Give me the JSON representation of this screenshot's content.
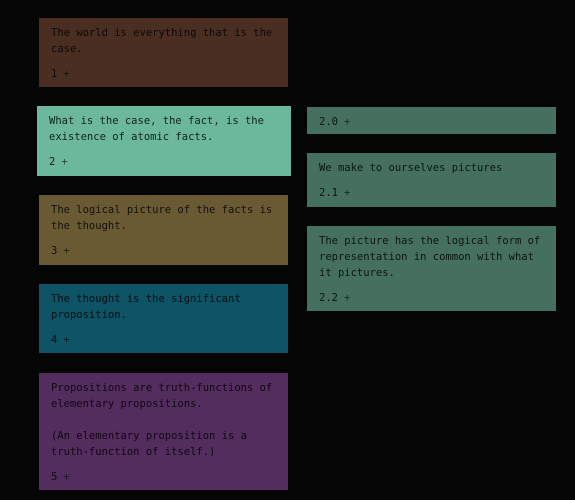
{
  "colors": {
    "background": "#050505",
    "card1": "#4a2e22",
    "card2": "#6cb89c",
    "card3": "#6a5a34",
    "card4": "#0e5366",
    "card5": "#522d5e",
    "child": "#45705f"
  },
  "main_column": [
    {
      "text": "The world is everything that is the case.",
      "number": "1",
      "add": "+"
    },
    {
      "text": "What is the case, the fact, is the existence of atomic facts.",
      "number": "2",
      "add": "+"
    },
    {
      "text": "The logical picture of the facts is the thought.",
      "number": "3",
      "add": "+"
    },
    {
      "text": "The thought is the significant proposition.",
      "number": "4",
      "add": "+"
    },
    {
      "text": "Propositions are truth-functions of elementary propositions.\n\n(An elementary proposition is a truth-function of itself.)",
      "number": "5",
      "add": "+"
    }
  ],
  "child_column": [
    {
      "text": "",
      "number": "2.0",
      "add": "+"
    },
    {
      "text": "We make to ourselves pictures",
      "number": "2.1",
      "add": "+"
    },
    {
      "text": "The picture has the logical form of representation in common with what it pictures.",
      "number": "2.2",
      "add": "+"
    }
  ]
}
